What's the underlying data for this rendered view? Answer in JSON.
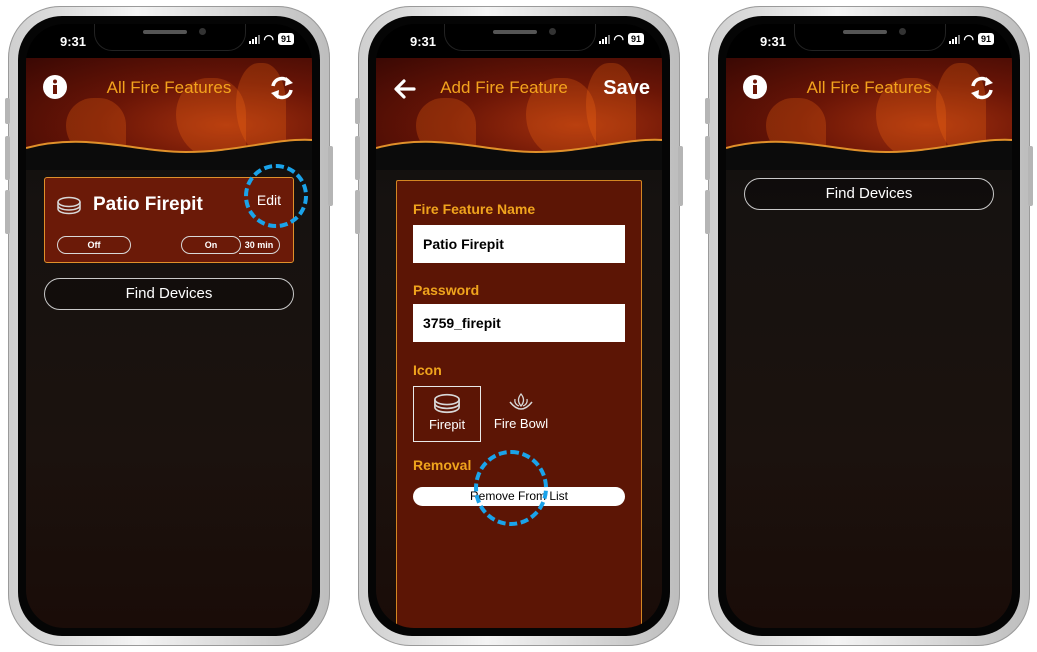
{
  "colors": {
    "accent": "#f3a31d",
    "card_border": "#e0902a",
    "highlight": "#1aa3ea",
    "panel": "#5c1505"
  },
  "status": {
    "time": "9:31",
    "battery": "91"
  },
  "screen1": {
    "header_title": "All Fire Features",
    "left_icon": "info-icon",
    "right_icon": "refresh-icon",
    "card": {
      "name": "Patio Firepit",
      "icon": "firepit-icon",
      "edit_label": "Edit",
      "off_label": "Off",
      "on_label": "On",
      "timer_label": "30 min"
    },
    "find_devices": "Find Devices"
  },
  "screen2": {
    "header_title": "Add Fire Feature",
    "back_icon": "back-arrow-icon",
    "save_label": "Save",
    "name_label": "Fire Feature Name",
    "name_value": "Patio Firepit",
    "password_label": "Password",
    "password_value": "3759_firepit",
    "icon_label": "Icon",
    "icon_options": [
      {
        "label": "Firepit",
        "icon": "firepit-icon",
        "selected": true
      },
      {
        "label": "Fire Bowl",
        "icon": "fire-bowl-icon",
        "selected": false
      }
    ],
    "removal_label": "Removal",
    "remove_button": "Remove From List"
  },
  "screen3": {
    "header_title": "All Fire Features",
    "left_icon": "info-icon",
    "right_icon": "refresh-icon",
    "find_devices": "Find Devices"
  }
}
